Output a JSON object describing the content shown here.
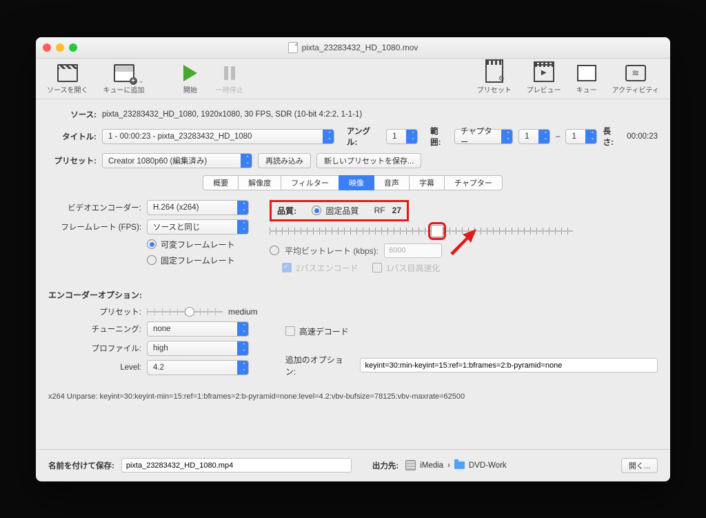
{
  "titlebar": {
    "filename": "pixta_23283432_HD_1080.mov"
  },
  "toolbar": {
    "open_source": "ソースを開く",
    "add_queue": "キューに追加",
    "start": "開始",
    "pause": "一時停止",
    "presets": "プリセット",
    "preview": "プレビュー",
    "queue": "キュー",
    "activity": "アクティビティ"
  },
  "header": {
    "source_label": "ソース:",
    "source_value": "pixta_23283432_HD_1080, 1920x1080, 30 FPS, SDR (10-bit 4:2:2, 1-1-1)",
    "title_label": "タイトル:",
    "title_value": "1 - 00:00:23 - pixta_23283432_HD_1080",
    "angle_label": "アングル:",
    "angle_value": "1",
    "range_label": "範囲:",
    "range_type": "チャプター",
    "range_from": "1",
    "range_to": "1",
    "range_sep": "–",
    "duration_label": "長さ:",
    "duration_value": "00:00:23",
    "preset_label": "プリセット:",
    "preset_value": "Creator 1080p60 (編集済み)",
    "reload": "再読み込み",
    "save_preset": "新しいプリセットを保存..."
  },
  "tabs": [
    "概要",
    "解像度",
    "フィルター",
    "映像",
    "音声",
    "字幕",
    "チャプター"
  ],
  "active_tab": 3,
  "video": {
    "encoder_label": "ビデオエンコーダー:",
    "encoder_value": "H.264 (x264)",
    "fps_label": "フレームレート (FPS):",
    "fps_value": "ソースと同じ",
    "vfr": "可変フレームレート",
    "cfr": "固定フレームレート",
    "quality_label": "品質:",
    "cq_label": "固定品質",
    "rf_label": "RF",
    "rf_value": "27",
    "abr": "平均ビットレート (kbps):",
    "bitrate": "6000",
    "twopass": "2パスエンコード",
    "turbo": "1パス目高速化"
  },
  "enc": {
    "section": "エンコーダーオプション:",
    "preset_label": "プリセット:",
    "preset_value": "medium",
    "tune_label": "チューニング:",
    "tune_value": "none",
    "fastdecode": "高速デコード",
    "profile_label": "プロファイル:",
    "profile_value": "high",
    "level_label": "Level:",
    "level_value": "4.2",
    "extra_label": "追加のオプション:",
    "extra_value": "keyint=30:min-keyint=15:ref=1:bframes=2:b-pyramid=none",
    "unparse": "x264 Unparse: keyint=30:keyint-min=15:ref=1:bframes=2:b-pyramid=none:level=4.2:vbv-bufsize=78125:vbv-maxrate=62500"
  },
  "footer": {
    "saveas_label": "名前を付けて保存:",
    "filename": "pixta_23283432_HD_1080.mp4",
    "dest_label": "出力先:",
    "path1": "iMedia",
    "path2": "DVD-Work",
    "browse": "開く..."
  }
}
